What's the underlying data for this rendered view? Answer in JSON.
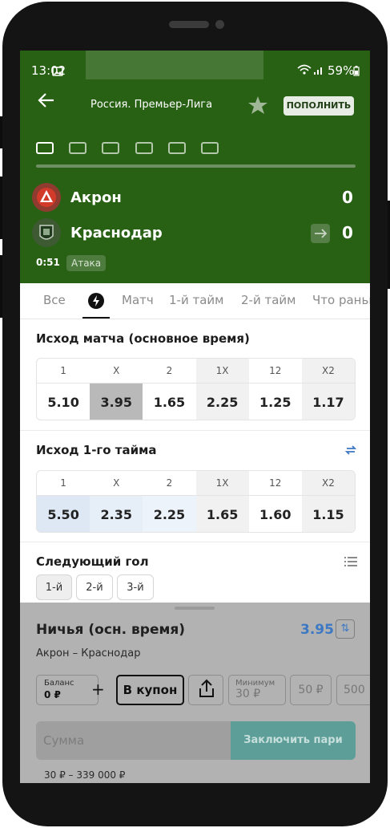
{
  "status": {
    "time": "13:02",
    "battery": "59%"
  },
  "header": {
    "league": "Россия. Премьер-Лига",
    "deposit_label": "ПОПОЛНИТЬ"
  },
  "teams": [
    {
      "name": "Акрон",
      "score": "0"
    },
    {
      "name": "Краснодар",
      "score": "0"
    }
  ],
  "match_state": {
    "time": "0:51",
    "phase": "Атака"
  },
  "market_tabs": [
    "Все",
    "Матч",
    "1-й тайм",
    "2-й тайм",
    "Что раньше"
  ],
  "markets": [
    {
      "title": "Исход матча (основное время)",
      "headers": [
        "1",
        "X",
        "2",
        "1X",
        "12",
        "X2"
      ],
      "values": [
        "5.10",
        "3.95",
        "1.65",
        "2.25",
        "1.25",
        "1.17"
      ],
      "selected_index": 1
    },
    {
      "title": "Исход 1-го тайма",
      "headers": [
        "1",
        "X",
        "2",
        "1X",
        "12",
        "X2"
      ],
      "values": [
        "5.50",
        "2.35",
        "2.25",
        "1.65",
        "1.60",
        "1.15"
      ]
    }
  ],
  "next_goal": {
    "title": "Следующий гол",
    "chips": [
      "1-й",
      "2-й",
      "3-й"
    ]
  },
  "coupon": {
    "title": "Ничья (осн. время)",
    "odds": "3.95",
    "matchup": "Акрон – Краснодар",
    "balance_label": "Баланс",
    "balance_value": "0 ₽",
    "plus": "+",
    "add_label": "В купон",
    "min_label": "Минимум",
    "min_value": "30 ₽",
    "quick_amounts": [
      "50 ₽",
      "500"
    ],
    "amount_placeholder": "Сумма",
    "submit_label": "Заключить пари",
    "range": "30 ₽ – 339 000 ₽"
  },
  "colors": {
    "header_bg": "#286114",
    "accent_blue": "#3c78c3",
    "submit_bg": "#5d9f98"
  }
}
